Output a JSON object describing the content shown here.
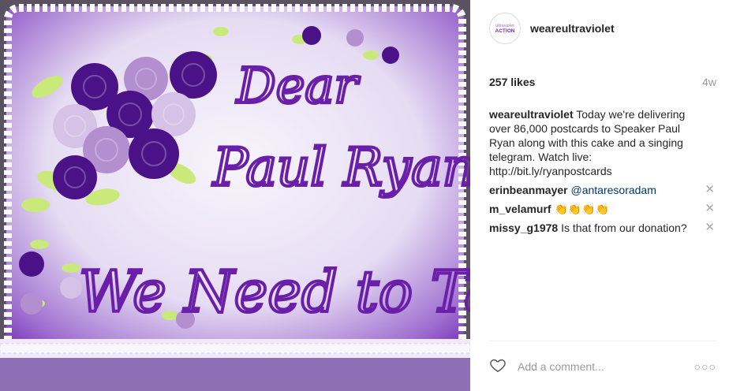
{
  "photo": {
    "cake_text_line1": "Dear",
    "cake_text_line2": "Paul Ryan",
    "cake_text_line3": "We Need to Talk"
  },
  "header": {
    "avatar_text_top": "ultraviolet",
    "avatar_text_bottom": "ACTION",
    "username": "weareultraviolet"
  },
  "post": {
    "likes": "257 likes",
    "time": "4w",
    "caption_user": "weareultraviolet",
    "caption_text": "Today we're delivering over 86,000 postcards to Speaker Paul Ryan along with this cake and a singing telegram. Watch live: http://bit.ly/ryanpostcards"
  },
  "comments": [
    {
      "user": "erinbeanmayer",
      "text": "@antaresoradam"
    },
    {
      "user": "m_velamurf",
      "text": "👏👏👏👏"
    },
    {
      "user": "missy_g1978",
      "text": "Is that from our donation?"
    }
  ],
  "footer": {
    "comment_placeholder": "Add a comment...",
    "more_label": "○○○"
  },
  "icons": {
    "heart": "heart-icon",
    "close": "close-icon",
    "more": "more-options-icon"
  },
  "colors": {
    "frosting_purple": "#6a1fa8",
    "rose_dark": "#4b1288",
    "rose_light": "#c9a6dc",
    "leaf_green": "#c9ea7a",
    "icing_white": "#f5f3fb"
  }
}
